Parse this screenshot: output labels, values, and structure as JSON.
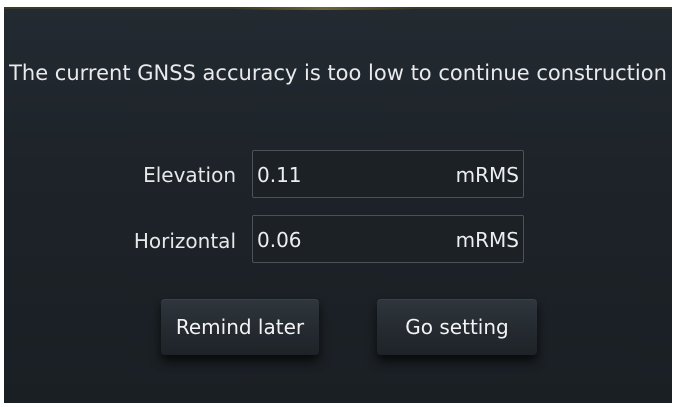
{
  "dialog": {
    "message": "The current GNSS accuracy is too low to continue construction",
    "fields": [
      {
        "label": "Elevation",
        "value": "0.11",
        "unit": "mRMS"
      },
      {
        "label": "Horizontal",
        "value": "0.06",
        "unit": "mRMS"
      }
    ],
    "buttons": {
      "remind_later": "Remind later",
      "go_setting": "Go setting"
    }
  },
  "colors": {
    "dialog_background": "#1f252b",
    "text": "#e8eaec",
    "field_border": "#4a5158",
    "top_accent": "#6f6431"
  }
}
